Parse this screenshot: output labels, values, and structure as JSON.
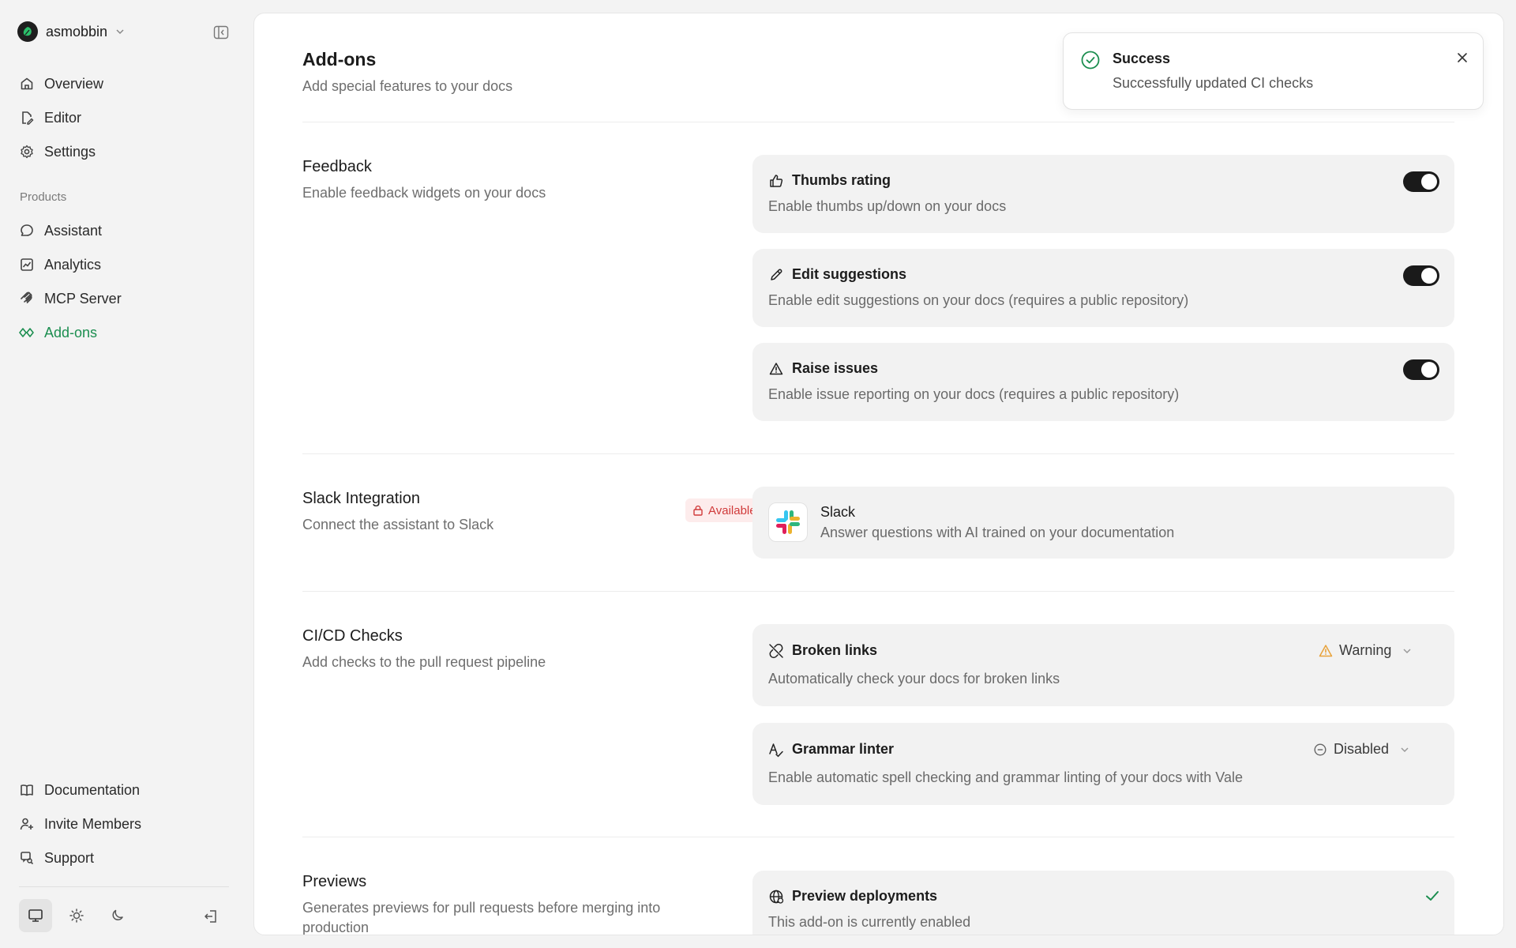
{
  "org": {
    "name": "asmobbin"
  },
  "nav": {
    "overview": "Overview",
    "editor": "Editor",
    "settings": "Settings",
    "section_products": "Products",
    "assistant": "Assistant",
    "analytics": "Analytics",
    "mcp_server": "MCP Server",
    "addons": "Add-ons",
    "documentation": "Documentation",
    "invite_members": "Invite Members",
    "support": "Support"
  },
  "page": {
    "title": "Add-ons",
    "subtitle": "Add special features to your docs"
  },
  "feedback": {
    "title": "Feedback",
    "description": "Enable feedback widgets on your docs",
    "items": [
      {
        "title": "Thumbs rating",
        "description": "Enable thumbs up/down on your docs",
        "enabled": true
      },
      {
        "title": "Edit suggestions",
        "description": "Enable edit suggestions on your docs (requires a public repository)",
        "enabled": true
      },
      {
        "title": "Raise issues",
        "description": "Enable issue reporting on your docs (requires a public repository)",
        "enabled": true
      }
    ]
  },
  "slack": {
    "title": "Slack Integration",
    "badge": "Available on Pro",
    "description": "Connect the assistant to Slack",
    "card_title": "Slack",
    "card_description": "Answer questions with AI trained on your documentation"
  },
  "cicd": {
    "title": "CI/CD Checks",
    "description": "Add checks to the pull request pipeline",
    "items": [
      {
        "title": "Broken links",
        "description": "Automatically check your docs for broken links",
        "status": "Warning"
      },
      {
        "title": "Grammar linter",
        "description": "Enable automatic spell checking and grammar linting of your docs with Vale",
        "status": "Disabled"
      }
    ]
  },
  "previews": {
    "title": "Previews",
    "description": "Generates previews for pull requests before merging into production",
    "card_title": "Preview deployments",
    "card_description": "This add-on is currently enabled"
  },
  "toast": {
    "title": "Success",
    "message": "Successfully updated CI checks"
  },
  "colors": {
    "accent": "#1c8e50",
    "warning": "#e8a23a",
    "danger": "#d03a3a",
    "toggle_on": "#1a1a1a"
  }
}
